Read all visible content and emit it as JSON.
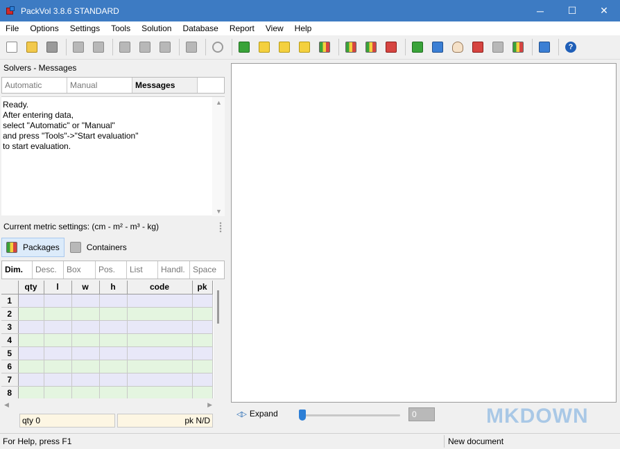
{
  "window": {
    "title": "PackVol 3.8.6 STANDARD",
    "minimize": "─",
    "maximize": "☐",
    "close": "✕"
  },
  "menu": [
    "File",
    "Options",
    "Settings",
    "Tools",
    "Solution",
    "Database",
    "Report",
    "View",
    "Help"
  ],
  "toolbar": {
    "icons": [
      "new-doc-icon",
      "open-folder-icon",
      "save-disk-icon",
      "cut-icon",
      "copy-icon",
      "paste-icon",
      "print-icon",
      "print-preview-icon",
      "export-dropdown-icon",
      "settings-gear-icon",
      "package-add-icon",
      "edit-icon",
      "database-icon",
      "containers-icon",
      "people-icon",
      "chart-icon",
      "tree-icon",
      "layers-icon",
      "refresh-icon",
      "grid-view-icon",
      "hand-icon",
      "split-icon",
      "zoom-dropdown-icon",
      "layout-icon",
      "fit-icon",
      "help-icon"
    ]
  },
  "solvers": {
    "header": "Solvers - Messages",
    "tabs": [
      {
        "label": "Automatic",
        "active": false
      },
      {
        "label": "Manual",
        "active": false
      },
      {
        "label": "Messages",
        "active": true
      }
    ],
    "message_lines": [
      "Ready.",
      "After entering data,",
      "select \"Automatic\" or \"Manual\"",
      "and press \"Tools\"->\"Start evaluation\"",
      "to start evaluation."
    ]
  },
  "metric": {
    "label": "Current metric settings: (cm - m² - m³ - kg)"
  },
  "category_tabs": [
    {
      "label": "Packages",
      "active": true,
      "icon": "packages-icon"
    },
    {
      "label": "Containers",
      "active": false,
      "icon": "containers-icon"
    }
  ],
  "detail_tabs": [
    {
      "label": "Dim.",
      "active": true
    },
    {
      "label": "Desc.",
      "active": false
    },
    {
      "label": "Box",
      "active": false
    },
    {
      "label": "Pos.",
      "active": false
    },
    {
      "label": "List",
      "active": false
    },
    {
      "label": "Handl.",
      "active": false
    },
    {
      "label": "Space",
      "active": false
    }
  ],
  "grid": {
    "columns": [
      "",
      "qty",
      "l",
      "w",
      "h",
      "code",
      "pk"
    ],
    "rows": [
      "1",
      "2",
      "3",
      "4",
      "5",
      "6",
      "7",
      "8"
    ]
  },
  "summary": {
    "qty": "qty 0",
    "pk": "pk N/D"
  },
  "bottom": {
    "expand_label": "Expand",
    "zoom_value": "0",
    "zoom_level": 0,
    "watermark": "MKDOWN"
  },
  "status": {
    "help": "For Help, press F1",
    "document": "New document"
  }
}
